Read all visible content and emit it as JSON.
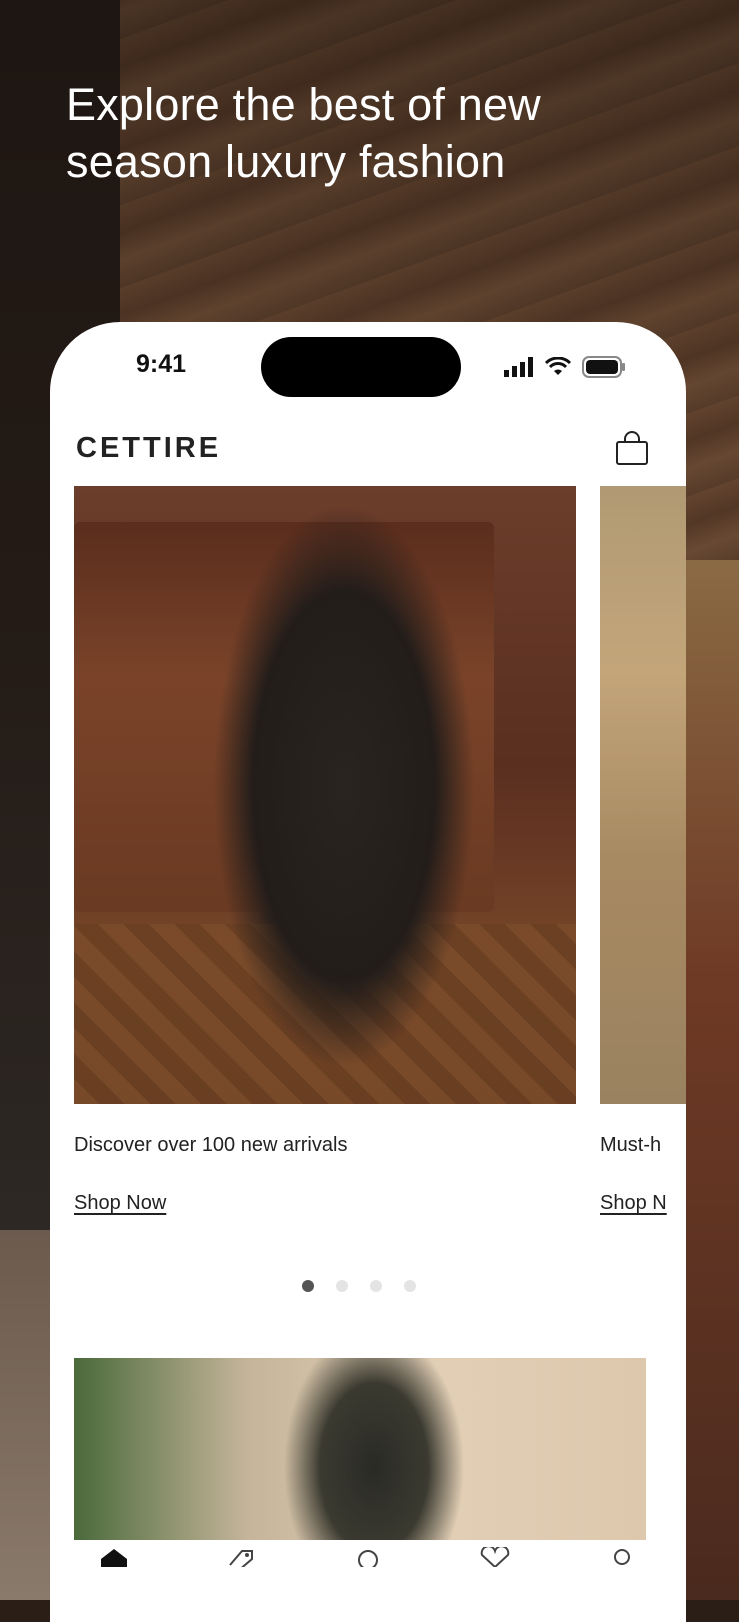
{
  "headline": "Explore the best of new season luxury fashion",
  "status_bar": {
    "time": "9:41",
    "icons": [
      "cellular-signal-icon",
      "wifi-icon",
      "battery-icon"
    ]
  },
  "app": {
    "brand": "CETTIRE",
    "cart_icon": "shopping-bag-icon"
  },
  "carousel": {
    "cards": [
      {
        "caption": "Discover over 100 new arrivals",
        "link": "Shop Now"
      },
      {
        "caption": "Must-h",
        "link": "Shop N"
      }
    ],
    "pages": 4,
    "active_page": 1
  },
  "tab_bar": {
    "items": [
      "home-icon",
      "tag-icon",
      "search-icon",
      "heart-icon",
      "account-icon"
    ],
    "active": "home-icon"
  },
  "colors": {
    "text_dark": "#222222",
    "dot_active": "#555555",
    "dot_inactive": "#e4e4e4"
  }
}
